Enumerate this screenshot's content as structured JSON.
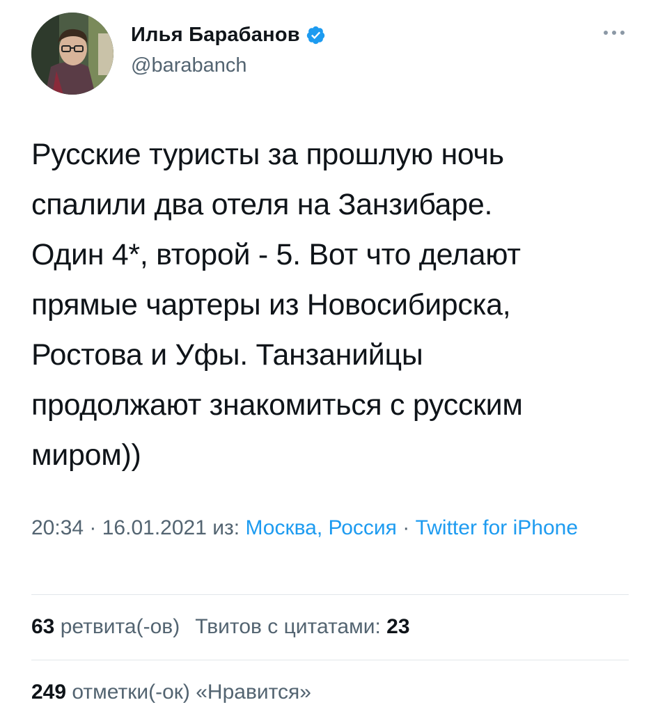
{
  "author": {
    "display_name": "Илья Барабанов",
    "handle": "@barabanch",
    "verified": true
  },
  "icons": {
    "verified": "verified-badge-icon",
    "more": "more-options-icon",
    "avatar": "profile-photo"
  },
  "colors": {
    "link": "#1d9bf0",
    "secondary_text": "#536471",
    "primary_text": "#0f1419",
    "divider": "#e1e6ea"
  },
  "tweet": {
    "text": "Русские туристы за прошлую ночь\nспалили два отеля на Занзибаре.\nОдин 4*, второй - 5. Вот что делают\nпрямые чартеры из Новосибирска,\nРостова и Уфы. Танзанийцы\nпродолжают знакомиться с русским\nмиром))"
  },
  "meta": {
    "time": "20:34",
    "sep1": " · ",
    "date": "16.01.2021",
    "from_label": " из: ",
    "location": "Москва, Россия",
    "sep2": " · ",
    "source": "Twitter for iPhone"
  },
  "stats": {
    "retweets_count": "63",
    "retweets_label": "ретвита(-ов)",
    "quotes_label": "Твитов с цитатами:",
    "quotes_count": "23",
    "likes_count": "249",
    "likes_label": "отметки(-ок) «Нравится»"
  }
}
